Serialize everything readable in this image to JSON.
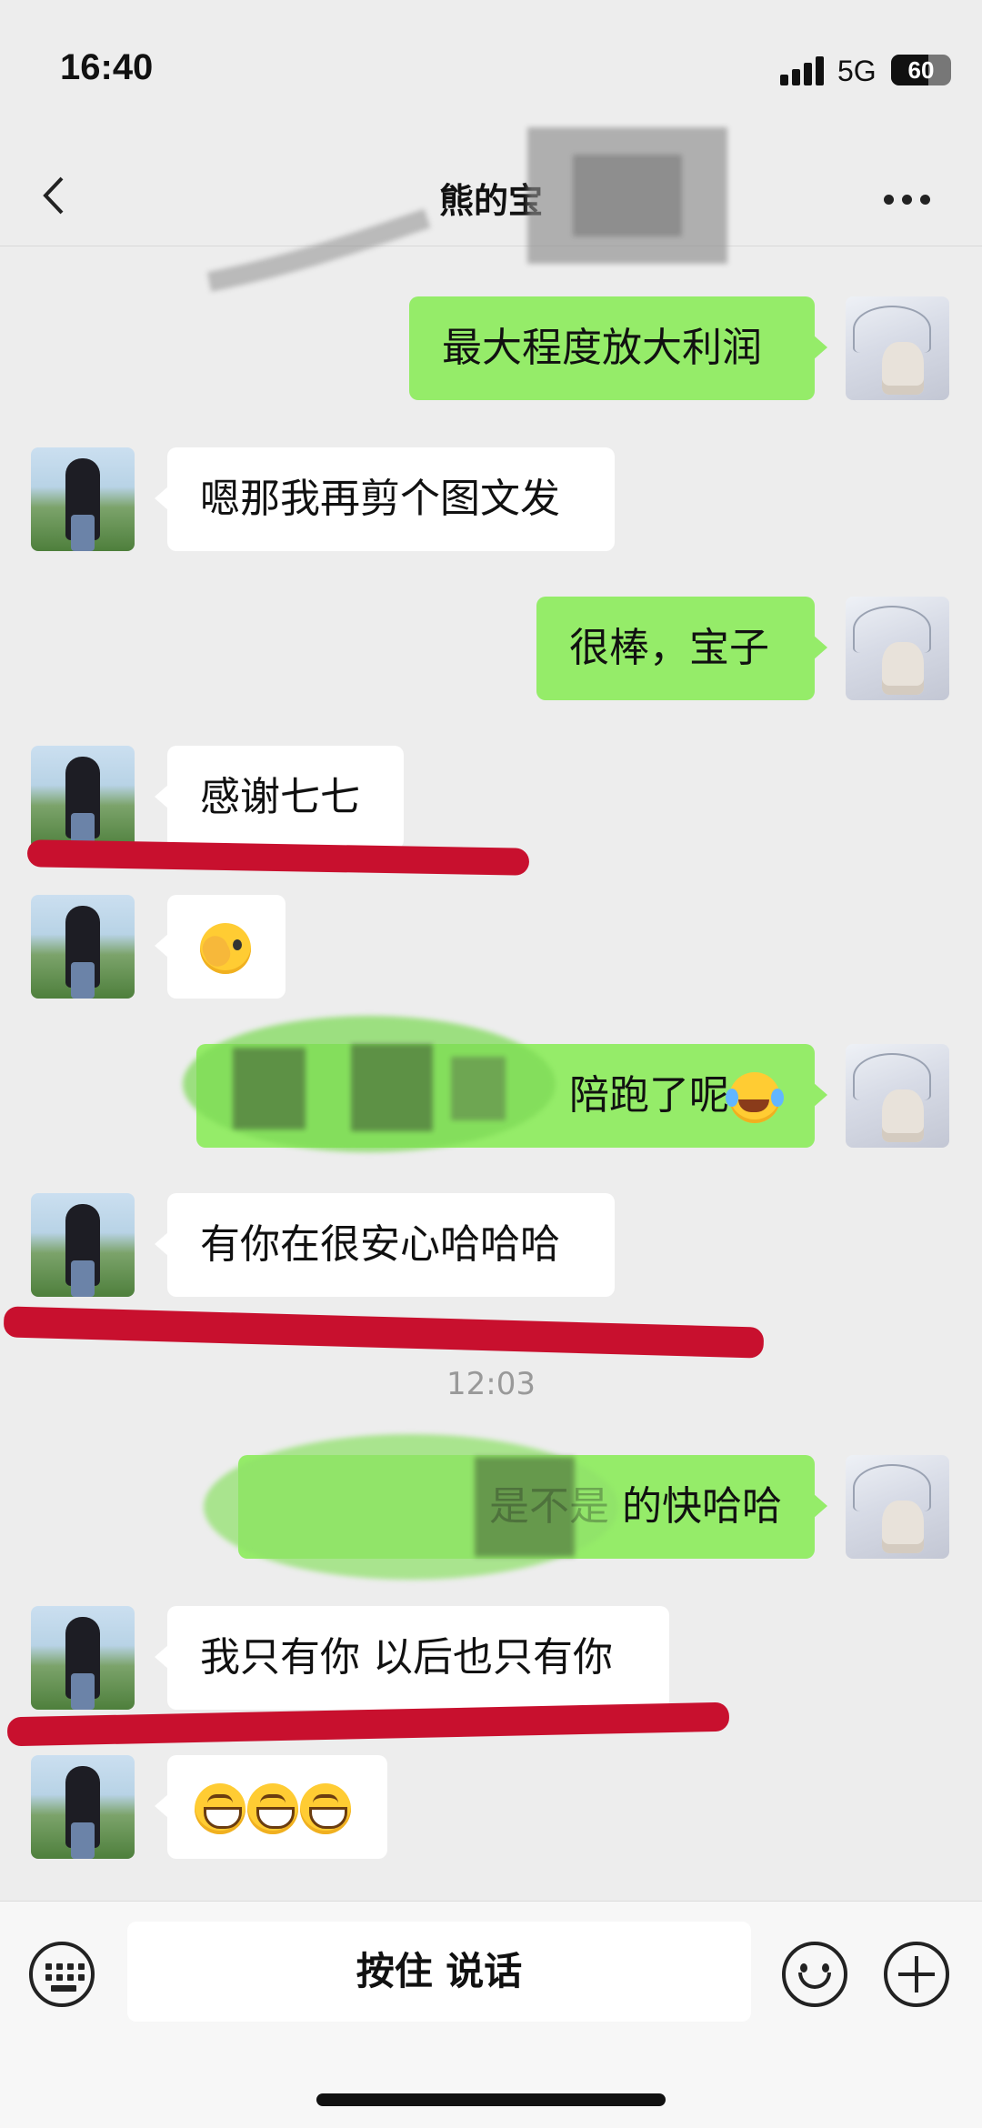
{
  "status": {
    "time": "16:40",
    "network": "5G",
    "battery": "60"
  },
  "header": {
    "title": "熊的宝",
    "back_icon": "chevron-left-icon",
    "more_icon": "more-dots-icon"
  },
  "messages": [
    {
      "side": "out",
      "text": "最大程度放大利润"
    },
    {
      "side": "in",
      "text": "嗯那我再剪个图文发"
    },
    {
      "side": "out",
      "text": "很棒，宝子"
    },
    {
      "side": "in",
      "text": "感谢七七"
    },
    {
      "side": "in",
      "emoji": "facepalm-emoji"
    },
    {
      "side": "out",
      "text": "陪跑了呢",
      "emoji": "laugh-cry-emoji"
    },
    {
      "side": "in",
      "text": "有你在很安心哈哈哈"
    },
    {
      "side": "out",
      "text": "是不是 的快哈哈"
    },
    {
      "side": "in",
      "text": "我只有你 以后也只有你"
    },
    {
      "side": "in",
      "emoji": "grin-emoji x3"
    }
  ],
  "timestamp": "12:03",
  "input": {
    "talk_label": "按住 说话",
    "keyboard_icon": "keyboard-icon",
    "emoji_icon": "smile-icon",
    "plus_icon": "plus-icon"
  },
  "colors": {
    "outgoing_bubble": "#95ec69",
    "incoming_bubble": "#ffffff",
    "background": "#ededed",
    "annotation_line": "#c8102e"
  }
}
